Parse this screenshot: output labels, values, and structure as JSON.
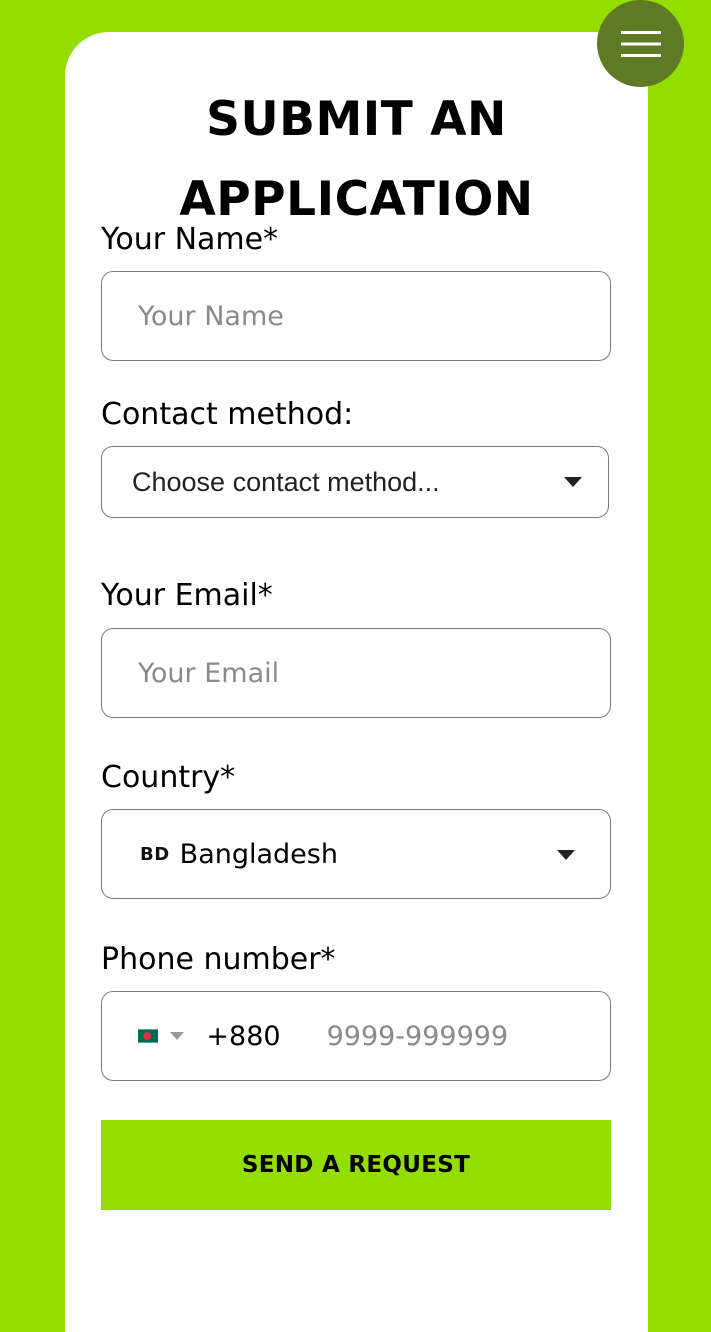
{
  "form": {
    "title": "SUBMIT AN APPLICATION",
    "name": {
      "label": "Your Name*",
      "placeholder": "Your Name"
    },
    "contact_method": {
      "label": "Contact method:",
      "selected": "Choose contact method..."
    },
    "email": {
      "label": "Your Email*",
      "placeholder": "Your Email"
    },
    "country": {
      "label": "Country*",
      "code": "BD",
      "selected": "Bangladesh"
    },
    "phone": {
      "label": "Phone number*",
      "dial_code": "+880",
      "placeholder": "9999-999999",
      "flag_colors": {
        "field": "#006a4e",
        "disc": "#f42a41"
      }
    },
    "submit_label": "SEND A REQUEST"
  },
  "menu": {
    "icon": "hamburger-menu-icon"
  },
  "colors": {
    "accent": "#94dd00",
    "menu_button": "#5f7a25",
    "border": "#7a7a7a",
    "placeholder": "#8a8a8a"
  }
}
